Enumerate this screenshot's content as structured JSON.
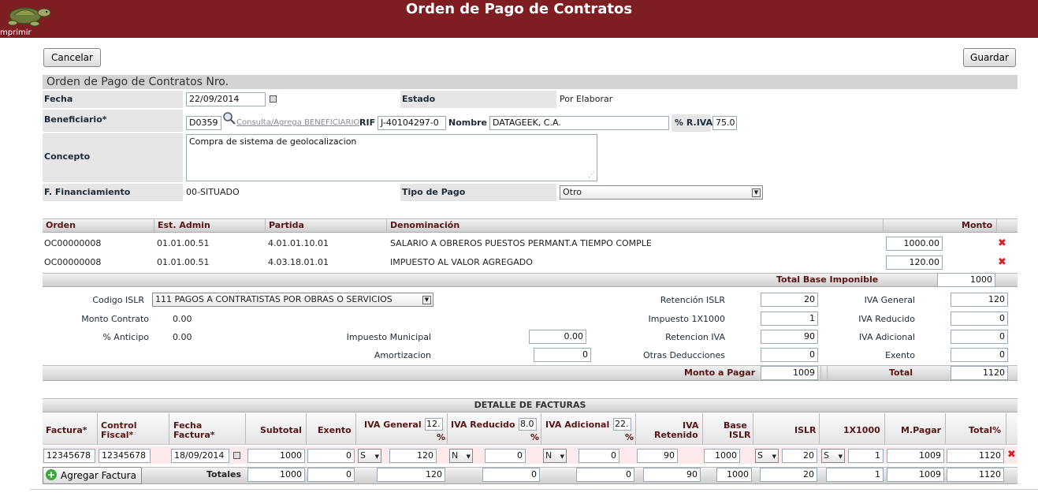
{
  "header": {
    "title": "Orden de Pago de Contratos",
    "print_label": "mprimir"
  },
  "actions": {
    "cancel": "Cancelar",
    "save": "Guardar"
  },
  "form": {
    "section_title": "Orden de Pago de Contratos Nro.",
    "fecha_label": "Fecha",
    "fecha": "22/09/2014",
    "estado_label": "Estado",
    "estado": "Por Elaborar",
    "beneficiario_label": "Beneficiario*",
    "beneficiario_code": "D0359",
    "consulta_link": "Consulta/Agrega BENEFICIARIO",
    "rif_label": "RIF",
    "rif": "J-40104297-0",
    "nombre_label": "Nombre",
    "nombre": "DATAGEEK, C.A.",
    "riva_label": "% R.IVA",
    "riva": "75.0",
    "concepto_label": "Concepto",
    "concepto": "Compra de sistema de geolocalizacion",
    "ffin_label": "F. Financiamiento",
    "ffin": "00-SITUADO",
    "tipo_pago_label": "Tipo de Pago",
    "tipo_pago": "Otro"
  },
  "items": {
    "headers": {
      "orden": "Orden",
      "est_admin": "Est. Admin",
      "partida": "Partida",
      "denominacion": "Denominación",
      "monto": "Monto"
    },
    "rows": [
      {
        "orden": "OC00000008",
        "est_admin": "01.01.00.51",
        "partida": "4.01.01.10.01",
        "denominacion": "SALARIO A OBREROS PUESTOS PERMANT.A TIEMPO COMPLE",
        "monto": "1000.00"
      },
      {
        "orden": "OC00000008",
        "est_admin": "01.01.00.51",
        "partida": "4.03.18.01.01",
        "denominacion": "IMPUESTO AL VALOR AGREGADO",
        "monto": "120.00"
      }
    ],
    "delete_glyph": "✖",
    "total_base_label": "Total Base Imponible",
    "total_base": "1000"
  },
  "calc": {
    "codigo_islr_label": "Codigo ISLR",
    "codigo_islr": "111 PAGOS A CONTRATISTAS POR OBRAS O SERVICIOS",
    "monto_contrato_label": "Monto Contrato",
    "monto_contrato": "0.00",
    "anticipo_label": "% Anticipo",
    "anticipo": "0.00",
    "imp_municipal_label": "Impuesto Municipal",
    "imp_municipal": "0.00",
    "amortizacion_label": "Amortizacion",
    "amortizacion": "0",
    "ret_islr_label": "Retención ISLR",
    "ret_islr": "20",
    "imp1x1000_label": "Impuesto 1X1000",
    "imp1x1000": "1",
    "ret_iva_label": "Retencion IVA",
    "ret_iva": "90",
    "otras_ded_label": "Otras Deducciones",
    "otras_ded": "0",
    "iva_general_label": "IVA General",
    "iva_general": "120",
    "iva_reducido_label": "IVA Reducido",
    "iva_reducido": "0",
    "iva_adicional_label": "IVA Adicional",
    "iva_adicional": "0",
    "exento_label": "Exento",
    "exento": "0",
    "monto_pagar_label": "Monto a Pagar",
    "monto_pagar": "1009",
    "total_label": "Total",
    "total": "1120"
  },
  "facturas": {
    "title": "DETALLE DE FACTURAS",
    "headers": {
      "factura": "Factura*",
      "control_a": "Control",
      "control_b": "Fiscal*",
      "fecha_a": "Fecha",
      "fecha_b": "Factura*",
      "subtotal": "Subtotal",
      "exento": "Exento",
      "iva_general": "IVA General",
      "iva_general_pct": "12.",
      "iva_reducido": "IVA Reducido",
      "iva_reducido_pct": "8.0",
      "iva_adicional": "IVA Adicional",
      "iva_adicional_pct": "22.",
      "pct": "%",
      "iva_ret_a": "IVA",
      "iva_ret_b": "Retenido",
      "base_a": "Base",
      "base_b": "ISLR",
      "islr": "ISLR",
      "x1000": "1X1000",
      "mpagar": "M.Pagar",
      "totalpct": "Total%"
    },
    "row": {
      "factura": "12345678",
      "control": "12345678",
      "fecha": "18/09/2014",
      "subtotal": "1000",
      "exento": "0",
      "iva_g_flag": "S",
      "iva_general": "120",
      "iva_r_flag": "N",
      "iva_reducido": "0",
      "iva_a_flag": "N",
      "iva_adicional": "0",
      "iva_retenido": "90",
      "base_islr": "1000",
      "islr_flag": "S",
      "islr": "20",
      "x1000_flag": "S",
      "x1000": "1",
      "mpagar": "1009",
      "total": "1120"
    },
    "add_label": "Agregar Factura",
    "totales_label": "Totales",
    "totales": {
      "subtotal": "1000",
      "exento": "0",
      "iva_general": "120",
      "iva_reducido": "0",
      "iva_adicional": "0",
      "iva_retenido": "90",
      "base_islr": "1000",
      "islr": "20",
      "x1000": "1",
      "mpagar": "1009",
      "total": "1120"
    }
  }
}
